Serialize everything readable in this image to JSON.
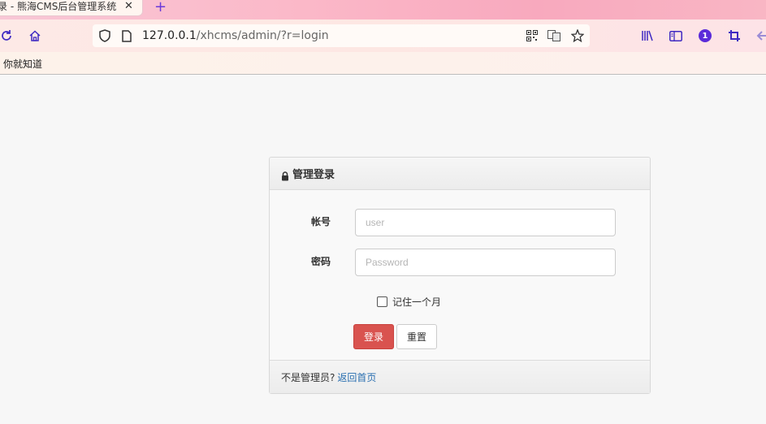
{
  "browser": {
    "tab_title": "录 - 熊海CMS后台管理系统",
    "tab_close": "✕",
    "new_tab": "+",
    "url_host": "127.0.0.1",
    "url_path": "/xhcms/admin/?r=login",
    "bookmark": "你就知道",
    "notification_count": "1",
    "accent_color": "#3f2ac2"
  },
  "login": {
    "title": "管理登录",
    "username_label": "帐号",
    "username_placeholder": "user",
    "password_label": "密码",
    "password_placeholder": "Password",
    "remember_label": "记住一个月",
    "submit_label": "登录",
    "reset_label": "重置",
    "footer_text": "不是管理员?",
    "footer_link": "返回首页",
    "submit_color": "#d9534f",
    "link_color": "#2a6fb0"
  }
}
